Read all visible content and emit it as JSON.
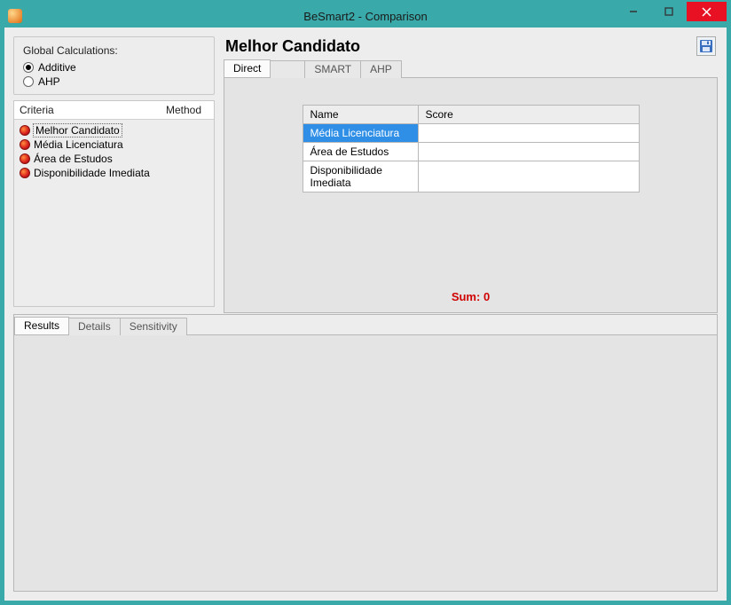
{
  "window": {
    "title": "BeSmart2 - Comparison"
  },
  "global_calc": {
    "legend": "Global Calculations:",
    "options": [
      {
        "label": "Additive",
        "checked": true
      },
      {
        "label": "AHP",
        "checked": false
      }
    ]
  },
  "criteria": {
    "col_name": "Criteria",
    "col_method": "Method",
    "items": [
      {
        "label": "Melhor Candidato",
        "selected": true
      },
      {
        "label": "Média Licenciatura",
        "selected": false
      },
      {
        "label": "Área de Estudos",
        "selected": false
      },
      {
        "label": "Disponibilidade Imediata",
        "selected": false
      }
    ]
  },
  "main": {
    "heading": "Melhor Candidato",
    "tabs": [
      {
        "label": "Direct",
        "active": true
      },
      {
        "label": "",
        "active": false
      },
      {
        "label": "SMART",
        "active": false
      },
      {
        "label": "AHP",
        "active": false
      }
    ],
    "table": {
      "col_name": "Name",
      "col_score": "Score",
      "rows": [
        {
          "name": "Média Licenciatura",
          "score": "",
          "selected": true
        },
        {
          "name": "Área de Estudos",
          "score": "",
          "selected": false
        },
        {
          "name": "Disponibilidade Imediata",
          "score": "",
          "selected": false
        }
      ]
    },
    "sum_label": "Sum:",
    "sum_value": "0"
  },
  "bottom": {
    "tabs": [
      {
        "label": "Results",
        "active": true
      },
      {
        "label": "Details",
        "active": false
      },
      {
        "label": "Sensitivity",
        "active": false
      }
    ]
  },
  "win_controls": {
    "minimize": "—",
    "maximize": "☐",
    "close": "✕"
  }
}
